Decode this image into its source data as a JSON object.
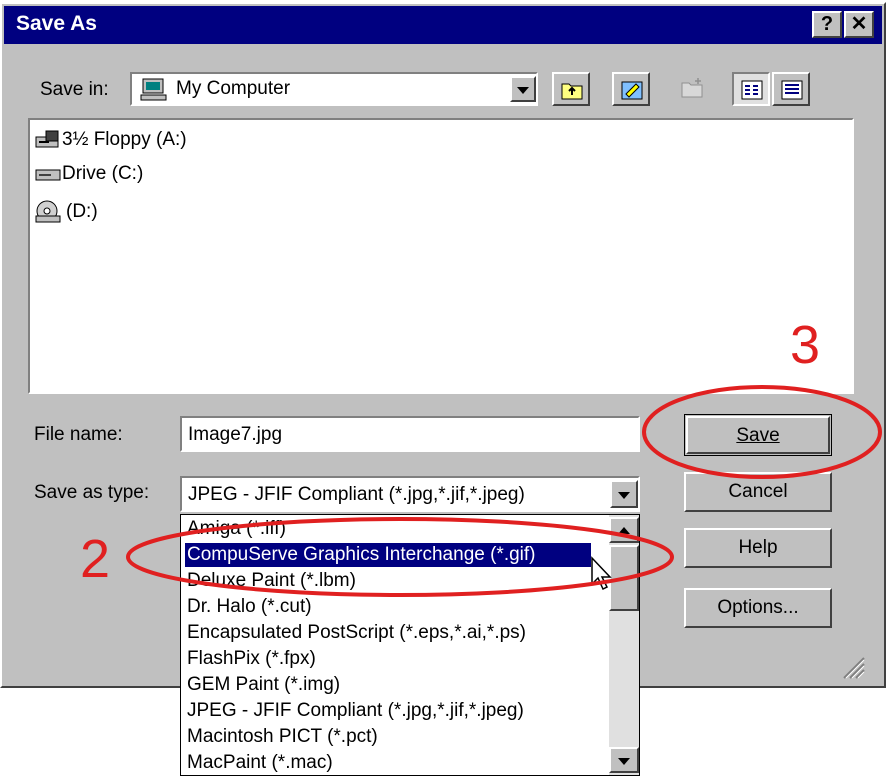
{
  "window": {
    "title": "Save As",
    "help_label": "?",
    "close_label": "✕"
  },
  "save_in": {
    "label": "Save in:",
    "value": "My Computer"
  },
  "file_list": [
    {
      "label": "3½ Floppy (A:)",
      "icon": "floppy-drive-icon"
    },
    {
      "label": "Drive (C:)",
      "icon": "hard-drive-icon"
    },
    {
      "label": "(D:)",
      "icon": "cd-drive-icon"
    }
  ],
  "file_name": {
    "label": "File name:",
    "value": "Image7.jpg"
  },
  "save_as_type": {
    "label": "Save as type:",
    "value": "JPEG - JFIF Compliant (*.jpg,*.jif,*.jpeg)"
  },
  "type_options": [
    "Amiga (*.iff)",
    "CompuServe Graphics Interchange (*.gif)",
    "Deluxe Paint (*.lbm)",
    "Dr. Halo (*.cut)",
    "Encapsulated PostScript (*.eps,*.ai,*.ps)",
    "FlashPix (*.fpx)",
    "GEM Paint (*.img)",
    "JPEG - JFIF Compliant (*.jpg,*.jif,*.jpeg)",
    "Macintosh PICT (*.pct)",
    "MacPaint (*.mac)"
  ],
  "buttons": {
    "save": "Save",
    "cancel": "Cancel",
    "help": "Help",
    "options": "Options..."
  },
  "annotations": {
    "step2": "2",
    "step3": "3",
    "color": "#e02020"
  },
  "colors": {
    "title_bar": "#000080",
    "face": "#c0c0c0",
    "selection": "#000080"
  }
}
